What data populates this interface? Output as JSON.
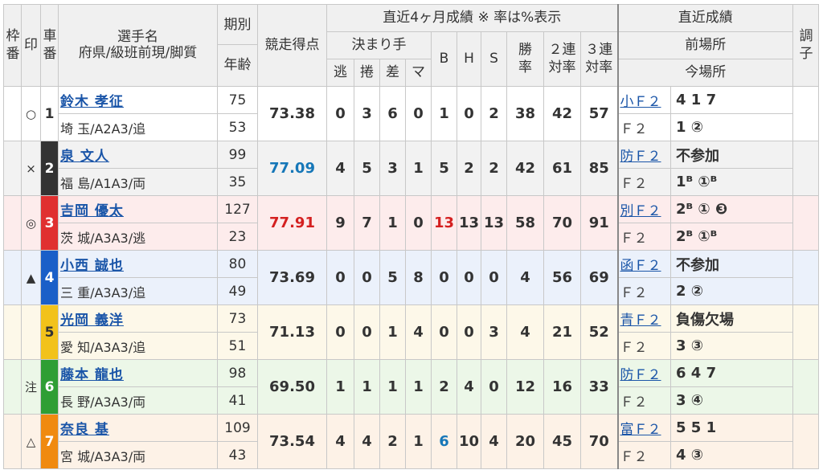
{
  "headers": {
    "waku": "枠番",
    "mark": "印",
    "car": "車番",
    "name": "選手名",
    "name_sub": "府県/級班前現/脚質",
    "term": "期別",
    "age": "年齢",
    "score": "競走得点",
    "recent4": "直近4ヶ月成績 ※ 率は%表示",
    "kimarite": "決まり手",
    "nige": "逃",
    "makuri": "捲",
    "sashi": "差",
    "ma": "マ",
    "b": "B",
    "h": "H",
    "s": "S",
    "win_rate": "勝率",
    "ren2": "２連対率",
    "ren3": "３連対率",
    "recent": "直近成績",
    "prev_venue": "前場所",
    "cur_venue": "今場所",
    "cond": "調子"
  },
  "riders": [
    {
      "mark": "○",
      "num": "1",
      "color": "#ffffff",
      "textcolor": "#333333",
      "name": "鈴木 孝征",
      "pref": "埼 玉/A2A3/追",
      "term": "75",
      "age": "53",
      "score": "73.38",
      "score_class": "",
      "nige": "0",
      "makuri": "3",
      "sashi": "6",
      "ma": "0",
      "b": "1",
      "h": "0",
      "s": "2",
      "win": "38",
      "r2": "42",
      "r3": "57",
      "prev": "小Ｆ２",
      "prev_res": "4 1 7",
      "cur": "Ｆ２",
      "cur_res": "1 ②"
    },
    {
      "mark": "×",
      "num": "2",
      "color": "#333333",
      "textcolor": "#ffffff",
      "name": "泉 文人",
      "pref": "福 島/A1A3/両",
      "term": "99",
      "age": "35",
      "score": "77.09",
      "score_class": "blue",
      "nige": "4",
      "makuri": "5",
      "sashi": "3",
      "ma": "1",
      "b": "5",
      "h": "2",
      "s": "2",
      "win": "42",
      "r2": "61",
      "r3": "85",
      "prev": "防Ｆ２",
      "prev_res": "不参加",
      "cur": "Ｆ２",
      "cur_res": "1ᴮ ①ᴮ"
    },
    {
      "mark": "◎",
      "num": "3",
      "color": "#e03030",
      "textcolor": "#ffffff",
      "name": "吉岡 優太",
      "pref": "茨 城/A3A3/逃",
      "term": "127",
      "age": "23",
      "score": "77.91",
      "score_class": "red",
      "nige": "9",
      "makuri": "7",
      "sashi": "1",
      "ma": "0",
      "b": "13",
      "h": "13",
      "s": "13",
      "win": "58",
      "r2": "70",
      "r3": "91",
      "prev": "別Ｆ２",
      "prev_res": "2ᴮ ① ❸",
      "cur": "Ｆ２",
      "cur_res": "2ᴮ ①ᴮ"
    },
    {
      "mark": "▲",
      "num": "4",
      "color": "#1a5fc8",
      "textcolor": "#ffffff",
      "name": "小西 誠也",
      "pref": "三 重/A3A3/追",
      "term": "80",
      "age": "49",
      "score": "73.69",
      "score_class": "",
      "nige": "0",
      "makuri": "0",
      "sashi": "5",
      "ma": "8",
      "b": "0",
      "h": "0",
      "s": "0",
      "win": "4",
      "r2": "56",
      "r3": "69",
      "prev": "函Ｆ２",
      "prev_res": "不参加",
      "cur": "Ｆ２",
      "cur_res": "2 ②"
    },
    {
      "mark": "",
      "num": "5",
      "color": "#f2c21a",
      "textcolor": "#333333",
      "name": "光岡 義洋",
      "pref": "愛 知/A3A3/追",
      "term": "73",
      "age": "51",
      "score": "71.13",
      "score_class": "",
      "nige": "0",
      "makuri": "0",
      "sashi": "1",
      "ma": "4",
      "b": "0",
      "h": "0",
      "s": "3",
      "win": "4",
      "r2": "21",
      "r3": "52",
      "prev": "青Ｆ２",
      "prev_res": "負傷欠場",
      "cur": "Ｆ２",
      "cur_res": "3 ③"
    },
    {
      "mark": "注",
      "num": "6",
      "color": "#2f9e34",
      "textcolor": "#ffffff",
      "name": "藤本 龍也",
      "pref": "長 野/A3A3/両",
      "term": "98",
      "age": "41",
      "score": "69.50",
      "score_class": "",
      "nige": "1",
      "makuri": "1",
      "sashi": "1",
      "ma": "1",
      "b": "2",
      "h": "4",
      "s": "0",
      "win": "12",
      "r2": "16",
      "r3": "33",
      "prev": "防Ｆ２",
      "prev_res": "6 4 7",
      "cur": "Ｆ２",
      "cur_res": "3 ④"
    },
    {
      "mark": "△",
      "num": "7",
      "color": "#f08a10",
      "textcolor": "#ffffff",
      "name": "奈良 基",
      "pref": "宮 城/A3A3/両",
      "term": "109",
      "age": "43",
      "score": "73.54",
      "score_class": "",
      "nige": "4",
      "makuri": "4",
      "sashi": "2",
      "ma": "1",
      "b": "6",
      "h": "10",
      "s": "4",
      "win": "20",
      "r2": "45",
      "r3": "70",
      "prev": "富Ｆ２",
      "prev_res": "5 5 1",
      "cur": "Ｆ２",
      "cur_res": "4 ③"
    }
  ]
}
